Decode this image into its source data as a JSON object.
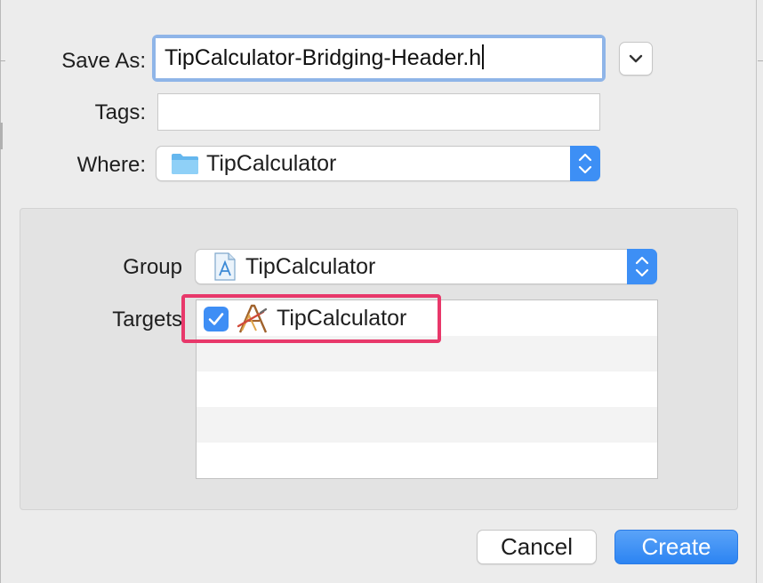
{
  "save_as": {
    "label": "Save As:",
    "value": "TipCalculator-Bridging-Header.h"
  },
  "tags": {
    "label": "Tags:",
    "value": ""
  },
  "where": {
    "label": "Where:",
    "value": "TipCalculator",
    "icon": "folder-icon"
  },
  "group": {
    "label": "Group",
    "value": "TipCalculator",
    "icon": "xcodeproj-file-icon"
  },
  "targets": {
    "label": "Targets",
    "items": [
      {
        "name": "TipCalculator",
        "checked": true,
        "icon": "app-target-icon"
      }
    ]
  },
  "buttons": {
    "cancel": "Cancel",
    "create": "Create"
  },
  "colors": {
    "accent": "#3d8ff5",
    "highlight": "#e8386a",
    "focus_ring": "#8fb5e8"
  }
}
